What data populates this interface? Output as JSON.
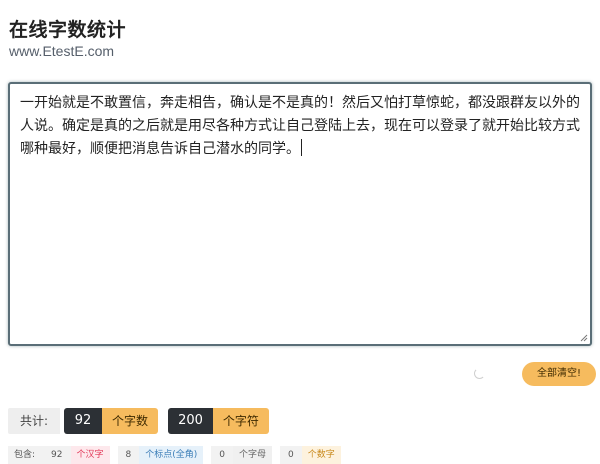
{
  "header": {
    "title": "在线字数统计",
    "subtitle": "www.EtestE.com"
  },
  "editor": {
    "text": "一开始就是不敢置信，奔走相告，确认是不是真的！然后又怕打草惊蛇，都没跟群友以外的人说。确定是真的之后就是用尽各种方式让自己登陆上去，现在可以登录了就开始比较方式哪种最好，顺便把消息告诉自己潜水的同学。"
  },
  "actions": {
    "clear_label": "全部清空!"
  },
  "totals": {
    "label": "共计:",
    "chars_count": "92",
    "chars_unit": "个字数",
    "symbols_count": "200",
    "symbols_unit": "个字符"
  },
  "details": {
    "label": "包含:",
    "hanzi_count": "92",
    "hanzi_unit": "个汉字",
    "punct_count": "8",
    "punct_unit": "个标点(全角)",
    "letters_count": "0",
    "letters_unit": "个字母",
    "digits_count": "0",
    "digits_unit": "个数字"
  },
  "colors": {
    "accent": "#f6bb5e",
    "dark": "#2c3035",
    "editor_border": "#5a6e77"
  },
  "icons": {
    "spinner": "loading-spinner-icon",
    "grip": "resize-grip-icon"
  }
}
